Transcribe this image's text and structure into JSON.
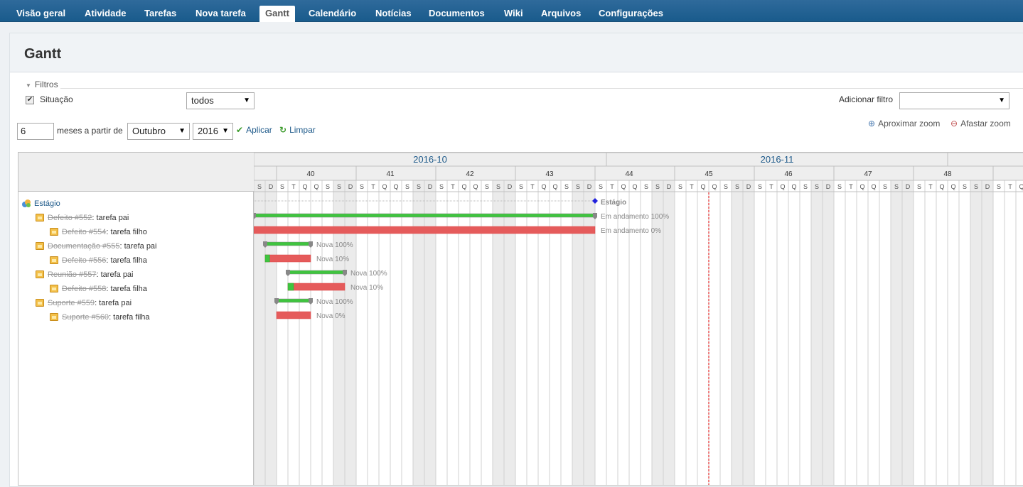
{
  "nav": {
    "tabs": [
      {
        "label": "Visão geral",
        "x": 0
      },
      {
        "label": "Atividade",
        "x": 0
      },
      {
        "label": "Tarefas",
        "x": 0
      },
      {
        "label": "Nova tarefa",
        "x": 0
      },
      {
        "label": "Gantt",
        "x": 0
      },
      {
        "label": "Calendário",
        "x": 0
      },
      {
        "label": "Notícias",
        "x": 0
      },
      {
        "label": "Documentos",
        "x": 0
      },
      {
        "label": "Wiki",
        "x": 0
      },
      {
        "label": "Arquivos",
        "x": 0
      },
      {
        "label": "Configurações",
        "x": 0
      }
    ],
    "selected": "Gantt"
  },
  "page": {
    "title": "Gantt"
  },
  "filters": {
    "legend": "Filtros",
    "status_label": "Situação",
    "status_checked": true,
    "status_value": "todos",
    "add_filter_label": "Adicionar filtro",
    "add_filter_value": ""
  },
  "range": {
    "months": "6",
    "months_label": "meses a partir de",
    "month": "Outubro",
    "year": "2016",
    "apply": "Aplicar",
    "clear": "Limpar"
  },
  "zoom": {
    "in": "Aproximar zoom",
    "out": "Afastar zoom"
  },
  "gantt": {
    "months": [
      "2016-10",
      "2016-11"
    ],
    "weeks": [
      "40",
      "41",
      "42",
      "43",
      "44",
      "45",
      "46",
      "47",
      "48"
    ],
    "day_letters": [
      "S",
      "T",
      "Q",
      "Q",
      "S",
      "S",
      "D"
    ],
    "project": {
      "name": "Estágio",
      "label": "Estágio"
    },
    "issues": [
      {
        "tracker_id": "Defeito #552",
        "subject": ": tarefa pai",
        "level": 1,
        "status_label": "Em andamento 100%"
      },
      {
        "tracker_id": "Defeito #554",
        "subject": ": tarefa filho",
        "level": 2,
        "status_label": "Em andamento 0%"
      },
      {
        "tracker_id": "Documentação #555",
        "subject": ": tarefa pai",
        "level": 1,
        "status_label": "Nova 100%"
      },
      {
        "tracker_id": "Defeito #556",
        "subject": ": tarefa filha",
        "level": 2,
        "status_label": "Nova 10%"
      },
      {
        "tracker_id": "Reunião #557",
        "subject": ": tarefa pai",
        "level": 1,
        "status_label": "Nova 100%"
      },
      {
        "tracker_id": "Defeito #558",
        "subject": ": tarefa filha",
        "level": 2,
        "status_label": "Nova 10%"
      },
      {
        "tracker_id": "Suporte #559",
        "subject": ": tarefa pai",
        "level": 1,
        "status_label": "Nova 100%"
      },
      {
        "tracker_id": "Suporte #560",
        "subject": ": tarefa filha",
        "level": 2,
        "status_label": "Nova 0%"
      }
    ],
    "colors": {
      "done": "#3fc43f",
      "todo": "#e55b5b",
      "weekend": "#ebebeb",
      "today_line": "#e00000",
      "milestone": "#2222dd"
    }
  }
}
